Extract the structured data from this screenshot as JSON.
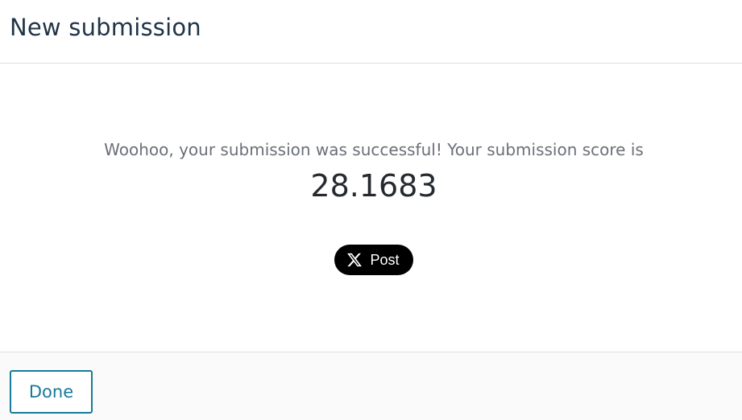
{
  "header": {
    "title": "New submission"
  },
  "body": {
    "message": "Woohoo, your submission was successful! Your submission score is",
    "score": "28.1683",
    "share_button": {
      "icon": "x-logo-icon",
      "label": "Post",
      "background": "#000000",
      "text_color": "#ffffff"
    }
  },
  "footer": {
    "done_label": "Done",
    "accent_color": "#177a99"
  }
}
